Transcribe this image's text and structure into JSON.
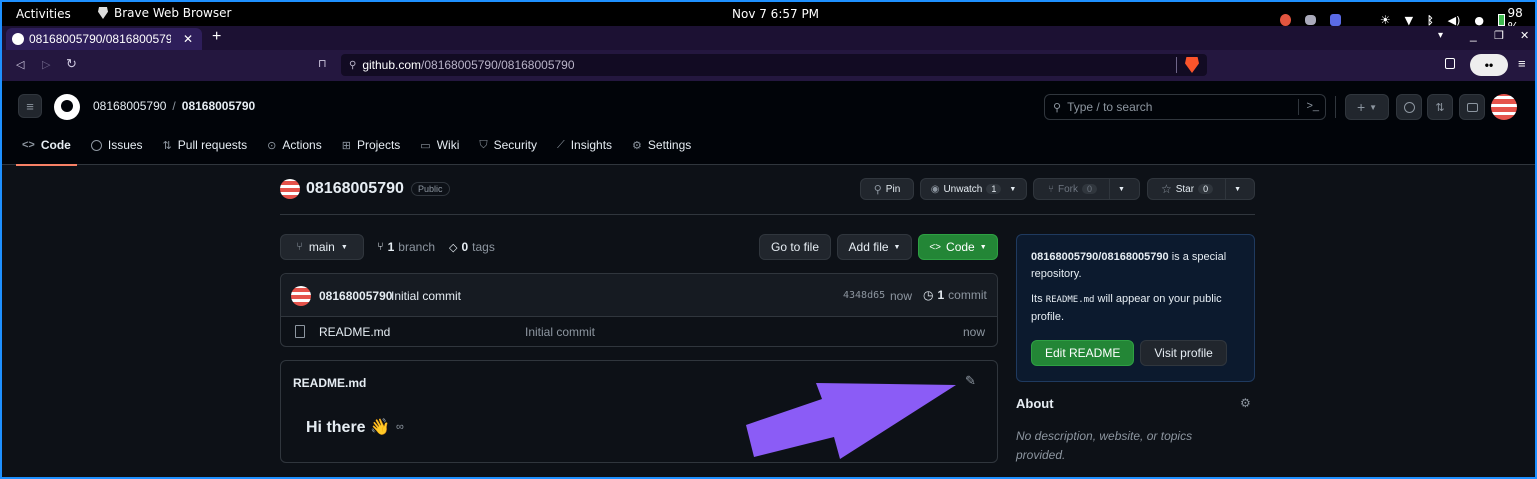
{
  "os": {
    "activities": "Activities",
    "app_name": "Brave Web Browser",
    "datetime": "Nov 7  6:57 PM",
    "battery": "98 %"
  },
  "browser": {
    "tab_title": "08168005790/08168005790",
    "url_host": "github.com",
    "url_path": "/08168005790/08168005790"
  },
  "github": {
    "owner": "08168005790",
    "repo": "08168005790",
    "search_placeholder": "Type / to search",
    "nav": [
      {
        "label": "Code",
        "icon": "code-icon"
      },
      {
        "label": "Issues",
        "icon": "issue-icon"
      },
      {
        "label": "Pull requests",
        "icon": "pull-request-icon"
      },
      {
        "label": "Actions",
        "icon": "play-icon"
      },
      {
        "label": "Projects",
        "icon": "table-icon"
      },
      {
        "label": "Wiki",
        "icon": "book-icon"
      },
      {
        "label": "Security",
        "icon": "shield-icon"
      },
      {
        "label": "Insights",
        "icon": "graph-icon"
      },
      {
        "label": "Settings",
        "icon": "gear-icon"
      }
    ]
  },
  "repo": {
    "name": "08168005790",
    "visibility": "Public",
    "pin_label": "Pin",
    "unwatch_label": "Unwatch",
    "unwatch_count": "1",
    "fork_label": "Fork",
    "fork_count": "0",
    "star_label": "Star",
    "star_count": "0",
    "branch": "main",
    "branches_count": "1",
    "branches_label": "branch",
    "tags_count": "0",
    "tags_label": "tags",
    "go_to_file": "Go to file",
    "add_file": "Add file",
    "code_button": "Code",
    "commit_author": "08168005790",
    "commit_message": "Initial commit",
    "commit_hash": "4348d65",
    "commit_time": "now",
    "commit_count": "1",
    "commit_label": "commit",
    "files": [
      {
        "name": "README.md",
        "message": "Initial commit",
        "time": "now"
      }
    ],
    "readme_title": "README.md",
    "readme_heading": "Hi there 👋"
  },
  "sidebar": {
    "special_repo_name": "08168005790/08168005790",
    "special_text": "is a special repository.",
    "readme_note_pre": "Its",
    "readme_note_code": "README.md",
    "readme_note_post": "will appear on your public profile.",
    "edit_readme": "Edit README",
    "visit_profile": "Visit profile",
    "about_title": "About",
    "about_text": "No description, website, or topics provided."
  },
  "colors": {
    "accent_green": "#238636",
    "annotation_arrow": "#8b5cf6",
    "tab_underline": "#f78166"
  }
}
